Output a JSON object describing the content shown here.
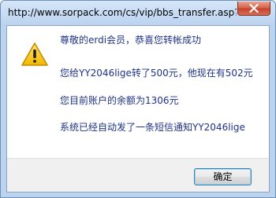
{
  "window": {
    "title": "http://www.sorpack.com/cs/vip/bbs_transfer.asp?t..."
  },
  "icons": {
    "close": "close-icon",
    "alert": "warning-icon"
  },
  "dialog": {
    "line1": "尊敬的erdi会员，恭喜您转帐成功",
    "line2": "您给YY2046lige转了500元，他现在有502元",
    "line3": "您目前账户的余额为1306元",
    "line4": "系统已经自动发了一条短信通知YY2046lige",
    "ok_label": "确定"
  },
  "colors": {
    "message_text": "#1e3287",
    "close_button": "#c5432b",
    "warning_fill": "#f5c400"
  }
}
